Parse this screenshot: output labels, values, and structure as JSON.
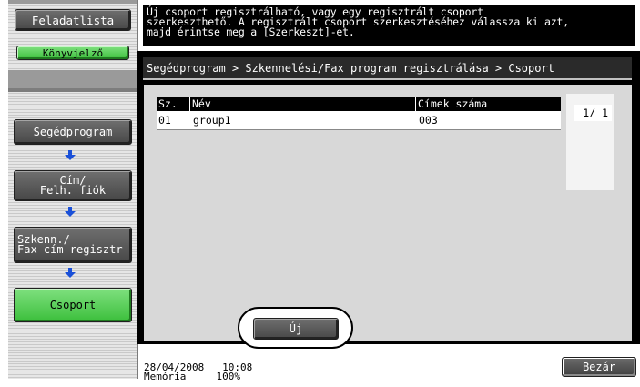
{
  "sidebar": {
    "job_list_label": "Feladatlista",
    "counter_label": "Könyvjelző",
    "breadcrumb_items": [
      "Segédprogram",
      "Cím/\nFelh. fiók",
      "Szkenn./\nFax cím regisztr",
      "Csoport"
    ]
  },
  "message": "Új csoport regisztrálható, vagy egy regisztrált csoport\nszerkeszthető. A regisztrált csoport szerkesztéséhez válassza ki azt,\nmajd érintse meg a [Szerkeszt]-et.",
  "breadcrumb": "Segédprogram > Szkennelési/Fax program regisztrálása > Csoport",
  "table": {
    "columns": [
      "Sz.",
      "Név",
      "Címek száma"
    ],
    "rows": [
      {
        "no": "01",
        "name": "group1",
        "count": "003"
      }
    ]
  },
  "pager": "1/  1",
  "new_button_label": "Új",
  "status": {
    "date": "28/04/2008",
    "time": "10:08",
    "memory_label": "Memória",
    "memory_value": "100%"
  },
  "close_button_label": "Bezár",
  "colors": {
    "accent_green": "#3cbf3c",
    "arrow_blue": "#1a50d8",
    "panel_gray": "#d8d8d8"
  }
}
